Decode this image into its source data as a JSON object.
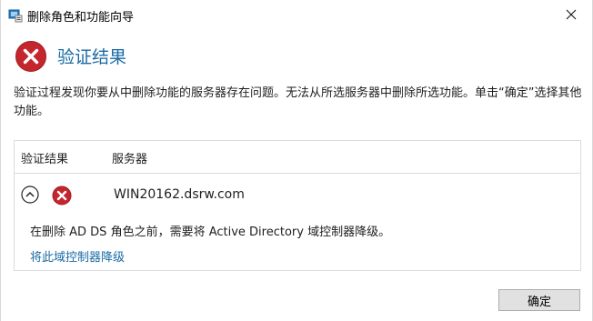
{
  "window": {
    "title": "删除角色和功能向导",
    "close_glyph": "✕"
  },
  "header": {
    "title": "验证结果",
    "icon": "error-icon"
  },
  "message": "验证过程发现你要从中删除功能的服务器存在问题。无法从所选服务器中删除所选功能。单击“确定”选择其他功能。",
  "results": {
    "columns": [
      "验证结果",
      "服务器"
    ],
    "rows": [
      {
        "status_icon": "error-icon",
        "server": "WIN20162.dsrw.com",
        "detail": "在删除 AD DS 角色之前，需要将 Active Directory 域控制器降级。",
        "link": "将此域控制器降级"
      }
    ]
  },
  "buttons": {
    "ok": "确定"
  },
  "colors": {
    "accent": "#1a6aa6",
    "error": "#c4262e"
  }
}
